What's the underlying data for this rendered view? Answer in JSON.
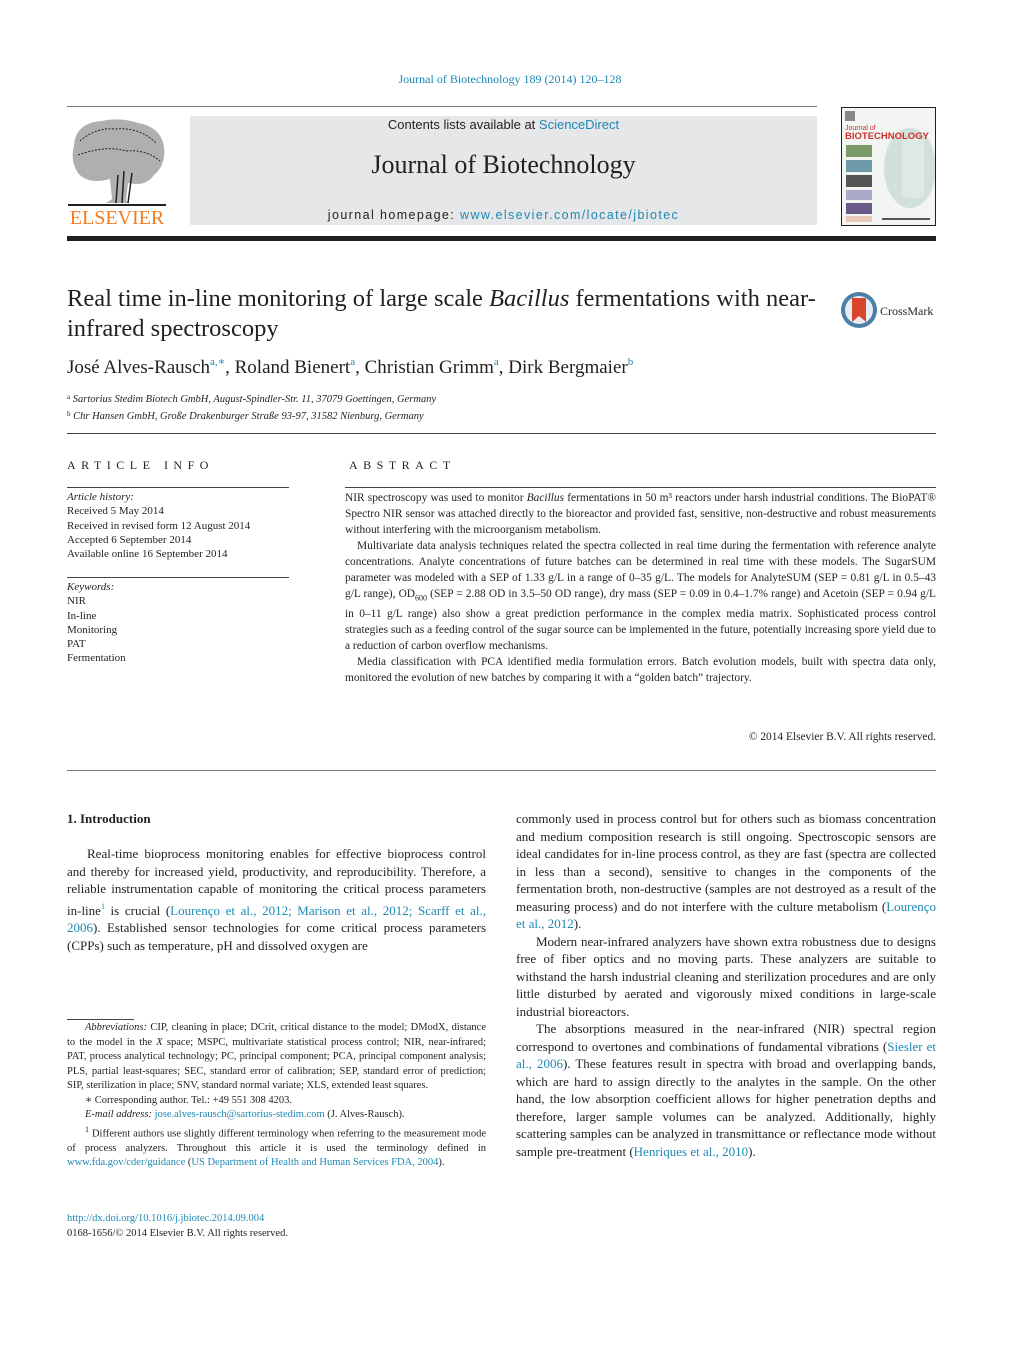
{
  "header": {
    "running_head": "Journal of Biotechnology 189 (2014) 120–128",
    "contents_prefix": "Contents lists available at ",
    "contents_link": "ScienceDirect",
    "journal_name": "Journal of Biotechnology",
    "homepage_prefix": "journal homepage: ",
    "homepage_link": "www.elsevier.com/locate/jbiotec",
    "publisher_logo_text": "ELSEVIER",
    "cover": {
      "line1": "Journal of",
      "line2": "BIOTECHNOLOGY"
    }
  },
  "colors": {
    "link": "#1e88b5",
    "elsevier_orange": "#f47b20",
    "banner_bg": "#e6e7e8",
    "cover_title": "#d0312d",
    "text": "#231f20"
  },
  "article": {
    "title_part1": "Real time in-line monitoring of large scale ",
    "title_italic": "Bacillus",
    "title_part2": " fermentations with near-infrared spectroscopy",
    "crossmark_label": "CrossMark",
    "authors": [
      {
        "name": "José Alves-Rausch",
        "sup": "a,∗"
      },
      {
        "name": "Roland Bienert",
        "sup": "a"
      },
      {
        "name": "Christian Grimm",
        "sup": "a"
      },
      {
        "name": "Dirk Bergmaier",
        "sup": "b"
      }
    ],
    "affiliations": [
      {
        "key": "a",
        "text": "Sartorius Stedim Biotech GmbH, August-Spindler-Str. 11, 37079 Goettingen, Germany"
      },
      {
        "key": "b",
        "text": "Chr Hansen GmbH, Große Drakenburger Straße 93-97, 31582 Nienburg, Germany"
      }
    ]
  },
  "article_info": {
    "heading": "ARTICLE INFO",
    "history_label": "Article history:",
    "history": [
      "Received 5 May 2014",
      "Received in revised form 12 August 2014",
      "Accepted 6 September 2014",
      "Available online 16 September 2014"
    ],
    "keywords_label": "Keywords:",
    "keywords": [
      "NIR",
      "In-line",
      "Monitoring",
      "PAT",
      "Fermentation"
    ]
  },
  "abstract": {
    "heading": "ABSTRACT",
    "p1_a": "NIR spectroscopy was used to monitor ",
    "p1_italic": "Bacillus",
    "p1_b": " fermentations in 50 m³ reactors under harsh industrial conditions. The BioPAT® Spectro NIR sensor was attached directly to the bioreactor and provided fast, sensitive, non-destructive and robust measurements without interfering with the microorganism metabolism.",
    "p2_a": "Multivariate data analysis techniques related the spectra collected in real time during the fermentation with reference analyte concentrations. Analyte concentrations of future batches can be determined in real time with these models. The SugarSUM parameter was modeled with a SEP of 1.33 g/L in a range of 0–35 g/L. The models for AnalyteSUM (SEP = 0.81 g/L in 0.5–43 g/L range), OD",
    "p2_sub": "600",
    "p2_b": " (SEP = 2.88 OD in 3.5–50 OD range), dry mass (SEP = 0.09 in 0.4–1.7% range) and Acetoin (SEP = 0.94 g/L in 0–11 g/L range) also show a great prediction performance in the complex media matrix. Sophisticated process control strategies such as a feeding control of the sugar source can be implemented in the future, potentially increasing spore yield due to a reduction of carbon overflow mechanisms.",
    "p3": "Media classification with PCA identified media formulation errors. Batch evolution models, built with spectra data only, monitored the evolution of new batches by comparing it with a “golden batch” trajectory.",
    "copyright": "© 2014 Elsevier B.V. All rights reserved."
  },
  "body": {
    "section_heading": "1.  Introduction",
    "left_p1_a": "Real-time bioprocess monitoring enables for effective bioprocess control and thereby for increased yield, productivity, and reproducibility. Therefore, a reliable instrumentation capable of monitoring the critical process parameters in-line",
    "left_p1_fn": "1",
    "left_p1_b": " is crucial (",
    "left_p1_cite": "Lourenço et al., 2012; Marison et al., 2012; Scarff et al., 2006",
    "left_p1_c": "). Established sensor technologies for come critical process parameters (CPPs) such as temperature, pH and dissolved oxygen are",
    "right_p1_a": "commonly used in process control but for others such as biomass concentration and medium composition research is still ongoing. Spectroscopic sensors are ideal candidates for in-line process control, as they are fast (spectra are collected in less than a second), sensitive to changes in the components of the fermentation broth, non-destructive (samples are not destroyed as a result of the measuring process) and do not interfere with the culture metabolism (",
    "right_p1_cite": "Lourenço et al., 2012",
    "right_p1_b": ").",
    "right_p2": "Modern near-infrared analyzers have shown extra robustness due to designs free of fiber optics and no moving parts. These analyzers are suitable to withstand the harsh industrial cleaning and sterilization procedures and are only little disturbed by aerated and vigorously mixed conditions in large-scale industrial bioreactors.",
    "right_p3_a": "The absorptions measured in the near-infrared (NIR) spectral region correspond to overtones and combinations of fundamental vibrations (",
    "right_p3_cite1": "Siesler et al., 2006",
    "right_p3_b": "). These features result in spectra with broad and overlapping bands, which are hard to assign directly to the analytes in the sample. On the other hand, the low absorption coefficient allows for higher penetration depths and therefore, larger sample volumes can be analyzed. Additionally, highly scattering samples can be analyzed in transmittance or reflectance mode without sample pre-treatment (",
    "right_p3_cite2": "Henriques et al., 2010",
    "right_p3_c": ")."
  },
  "footnotes": {
    "abbrev_label": "Abbreviations:",
    "abbrev_a": "  CIP, cleaning in place; DCrit, critical distance to the model; DModX, distance to the model in the ",
    "abbrev_x": "X",
    "abbrev_b": " space; MSPC, multivariate statistical process control; NIR, near-infrared; PAT, process analytical technology; PC, principal component; PCA, principal component analysis; PLS, partial least-squares; SEC, standard error of calibration; SEP, standard error of prediction; SIP, sterilization in place; SNV, standard normal variate; XLS, extended least squares.",
    "corresponding": "∗  Corresponding author. Tel.: +49 551 308 4203.",
    "email_label": "E-mail address:",
    "email": "jose.alves-rausch@sartorius-stedim.com",
    "email_suffix": " (J. Alves-Rausch).",
    "fn1_mark": "1",
    "fn1_a": " Different authors use slightly different terminology when referring to the measurement mode of process analyzers. Throughout this article it is used the terminology defined in ",
    "fn1_link": "www.fda.gov/cder/guidance",
    "fn1_b": " (",
    "fn1_cite": "US Department of Health and Human Services FDA, 2004",
    "fn1_c": ").",
    "doi": "http://dx.doi.org/10.1016/j.jbiotec.2014.09.004",
    "issn": "0168-1656/© 2014 Elsevier B.V. All rights reserved."
  }
}
